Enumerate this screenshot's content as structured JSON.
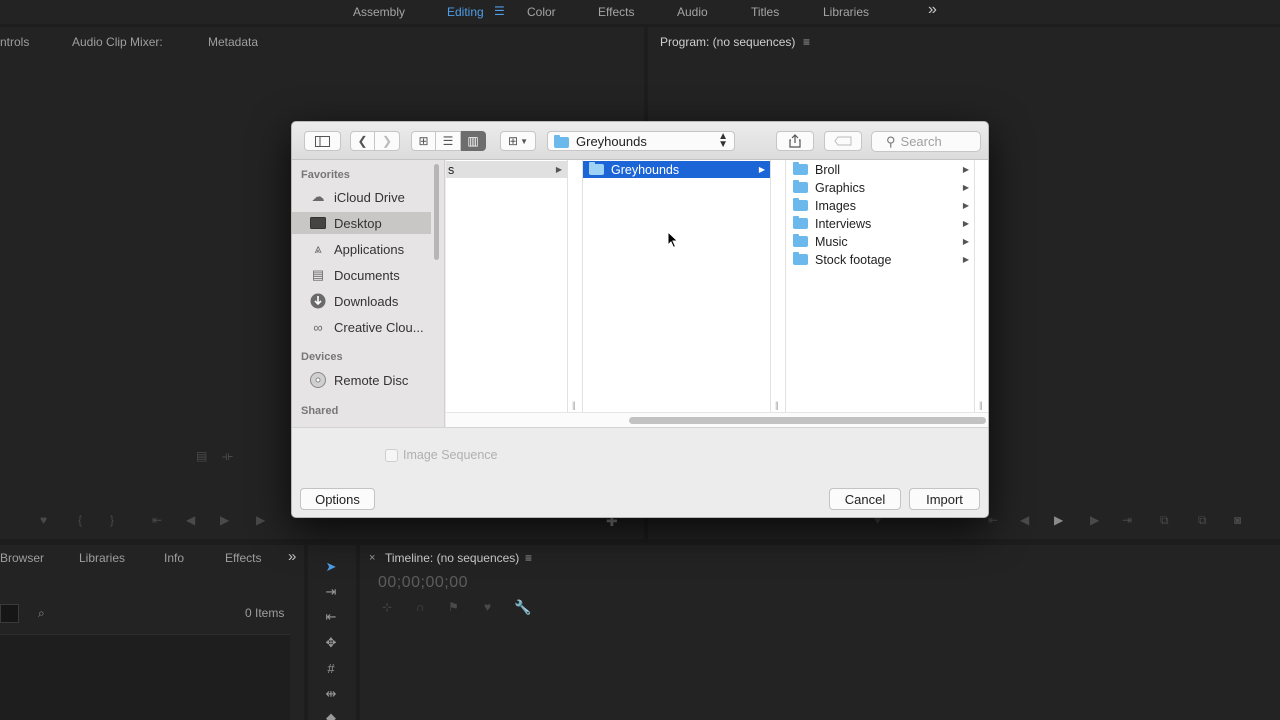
{
  "workspaces": {
    "tabs": [
      "Assembly",
      "Editing",
      "Color",
      "Effects",
      "Audio",
      "Titles",
      "Libraries"
    ],
    "active": "Editing",
    "more_glyph": "»"
  },
  "source_panel": {
    "tabs": [
      "ntrols",
      "Audio Clip Mixer:",
      "Metadata"
    ]
  },
  "program_panel": {
    "title": "Program: (no sequences)",
    "menu_glyph": "≡"
  },
  "project_panel": {
    "tabs": [
      "Browser",
      "Libraries",
      "Info",
      "Effects"
    ],
    "more_glyph": "»",
    "items_count": "0 Items"
  },
  "timeline_panel": {
    "close_glyph": "×",
    "title": "Timeline: (no sequences)",
    "menu_glyph": "≡",
    "timecode": "00;00;00;00"
  },
  "dialog": {
    "location": "Greyhounds",
    "search_placeholder": "Search",
    "sidebar": {
      "favorites_header": "Favorites",
      "favorites": [
        {
          "label": "iCloud Drive",
          "icon": "cloud-icon"
        },
        {
          "label": "Desktop",
          "icon": "desktop-icon",
          "selected": true
        },
        {
          "label": "Applications",
          "icon": "applications-icon"
        },
        {
          "label": "Documents",
          "icon": "documents-icon"
        },
        {
          "label": "Downloads",
          "icon": "downloads-icon"
        },
        {
          "label": "Creative Clou...",
          "icon": "creative-cloud-icon"
        }
      ],
      "devices_header": "Devices",
      "devices": [
        {
          "label": "Remote Disc",
          "icon": "disc-icon"
        }
      ],
      "shared_header": "Shared"
    },
    "columns": {
      "col1_item": "s",
      "col2_item": "Greyhounds",
      "col3_items": [
        "Broll",
        "Graphics",
        "Images",
        "Interviews",
        "Music",
        "Stock footage"
      ]
    },
    "image_sequence_label": "Image Sequence",
    "options_label": "Options",
    "cancel_label": "Cancel",
    "import_label": "Import"
  }
}
